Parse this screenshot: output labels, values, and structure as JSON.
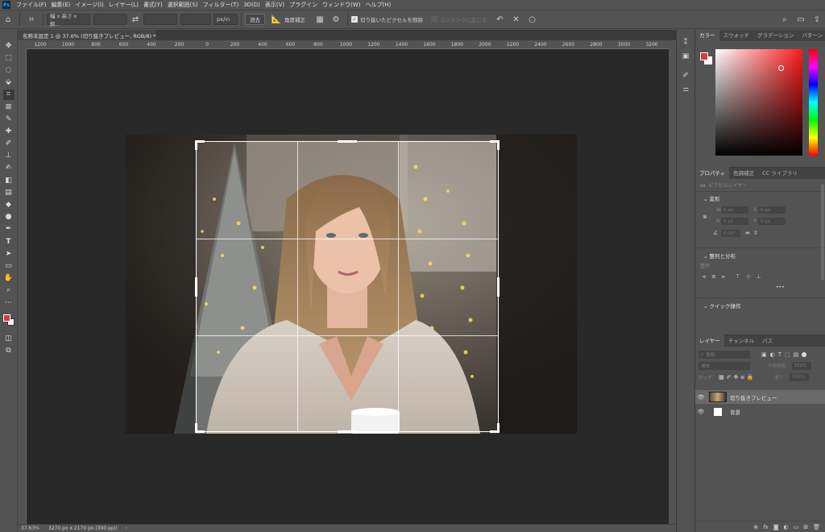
{
  "app": {
    "logo": "Ps"
  },
  "menu": [
    "ファイル(F)",
    "編集(E)",
    "イメージ(I)",
    "レイヤー(L)",
    "書式(Y)",
    "選択範囲(S)",
    "フィルター(T)",
    "3D(D)",
    "表示(V)",
    "プラグイン",
    "ウィンドウ(W)",
    "ヘルプ(H)"
  ],
  "options": {
    "ratio_select": "幅 x 高さ x 解…",
    "unit_select": "px/in",
    "clear_button": "消去",
    "straighten_label": "角度補正",
    "delete_cropped_label": "切り抜いたピクセルを削除",
    "delete_cropped_checked": true,
    "content_aware_label": "コンテンツに応じる",
    "content_aware_checked": false
  },
  "document": {
    "tab_title": "名称未設定 1 @ 37.6% (切り抜きプレビュー, RGB/8) *",
    "close_symbol": "×"
  },
  "ruler_top_labels": [
    "1200",
    "1000",
    "800",
    "600",
    "400",
    "200",
    "0",
    "200",
    "400",
    "600",
    "800",
    "1000",
    "1200",
    "1400",
    "1600",
    "1800",
    "2000",
    "2200",
    "2400",
    "2600",
    "2800",
    "3000",
    "3200"
  ],
  "status": {
    "zoom": "37.63%",
    "doc_info": "3270 px x 2170 px (300 ppi)",
    "arrow": "›"
  },
  "color_panel": {
    "tabs": [
      "カラー",
      "スウォッチ",
      "グラデーション",
      "パターン"
    ],
    "active_tab": "カラー",
    "foreground": "#d93a3a",
    "background": "#ffffff"
  },
  "properties_panel": {
    "tabs": [
      "プロパティ",
      "色調補正",
      "CC ライブラリ"
    ],
    "active_tab": "プロパティ",
    "layer_kind": "ピクセルレイヤー",
    "transform_title": "変形",
    "w_label": "W",
    "h_label": "H",
    "x_label": "X",
    "y_label": "Y",
    "w_value": "0 px",
    "h_value": "0 px",
    "x_value": "0 px",
    "y_value": "0 px",
    "angle_value": "0.00°",
    "align_title": "整列と分布",
    "align_sub": "整列",
    "more_symbol": "•••",
    "quick_actions_title": "クイック操作"
  },
  "layers_panel": {
    "tabs": [
      "レイヤー",
      "チャンネル",
      "パス"
    ],
    "active_tab": "レイヤー",
    "search_placeholder": "種類",
    "blend_mode": "通常",
    "opacity_label": "不透明度：",
    "opacity_value": "100%",
    "lock_label": "ロック：",
    "fill_label": "塗り：",
    "fill_value": "100%",
    "layers": [
      {
        "name": "切り抜きプレビュー",
        "visible": true,
        "selected": true
      },
      {
        "name": "背景",
        "visible": true,
        "selected": false
      }
    ]
  },
  "icons": {
    "options": [
      "home-icon",
      "crop-tool-icon",
      "swap-icon",
      "straighten-icon",
      "grid-overlay-icon",
      "gear-icon",
      "reset-icon",
      "cancel-icon",
      "commit-icon",
      "search-icon",
      "workspace-icon",
      "share-icon"
    ],
    "tools": [
      "move-icon",
      "marquee-icon",
      "lasso-icon",
      "object-select-icon",
      "crop-icon",
      "frame-icon",
      "eyedropper-icon",
      "healing-icon",
      "brush-icon",
      "stamp-icon",
      "history-brush-icon",
      "eraser-icon",
      "gradient-icon",
      "blur-icon",
      "dodge-icon",
      "pen-icon",
      "type-icon",
      "path-select-icon",
      "rectangle-icon",
      "hand-icon",
      "zoom-icon",
      "more-tools-icon"
    ]
  }
}
